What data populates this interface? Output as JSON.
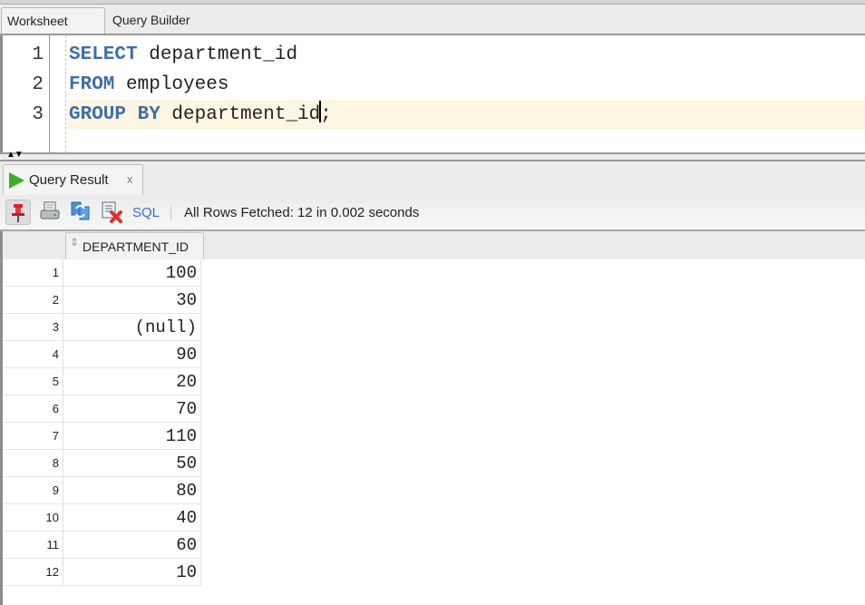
{
  "editor_tabs": [
    {
      "label": "Worksheet",
      "active": true
    },
    {
      "label": "Query Builder",
      "active": false
    }
  ],
  "editor": {
    "lines": [
      {
        "number": "1",
        "keyword": "SELECT",
        "rest": " department_id",
        "after_caret": ""
      },
      {
        "number": "2",
        "keyword": "FROM",
        "rest": " employees",
        "after_caret": ""
      },
      {
        "number": "3",
        "keyword": "GROUP BY",
        "rest": " department_id",
        "after_caret": ";"
      }
    ],
    "current_line": 3,
    "keyword_color": "#3e6ea8",
    "current_line_bg": "#fdf6e3"
  },
  "splitter": {
    "arrows": "▲▼"
  },
  "result_tab": {
    "label": "Query Result",
    "close_glyph": "x",
    "icon": "run-triangle-icon"
  },
  "toolbar": {
    "icons": [
      "pin-icon",
      "print-icon",
      "refresh-icon",
      "delete-icon"
    ],
    "sql_label": "SQL",
    "separator": "|",
    "status": "All Rows Fetched: 12 in 0.002 seconds"
  },
  "grid": {
    "columns": [
      "DEPARTMENT_ID"
    ],
    "sort_glyph": "⇕",
    "rows": [
      {
        "num": "1",
        "value": "100"
      },
      {
        "num": "2",
        "value": "30"
      },
      {
        "num": "3",
        "value": "(null)"
      },
      {
        "num": "4",
        "value": "90"
      },
      {
        "num": "5",
        "value": "20"
      },
      {
        "num": "6",
        "value": "70"
      },
      {
        "num": "7",
        "value": "110"
      },
      {
        "num": "8",
        "value": "50"
      },
      {
        "num": "9",
        "value": "80"
      },
      {
        "num": "10",
        "value": "40"
      },
      {
        "num": "11",
        "value": "60"
      },
      {
        "num": "12",
        "value": "10"
      }
    ]
  }
}
